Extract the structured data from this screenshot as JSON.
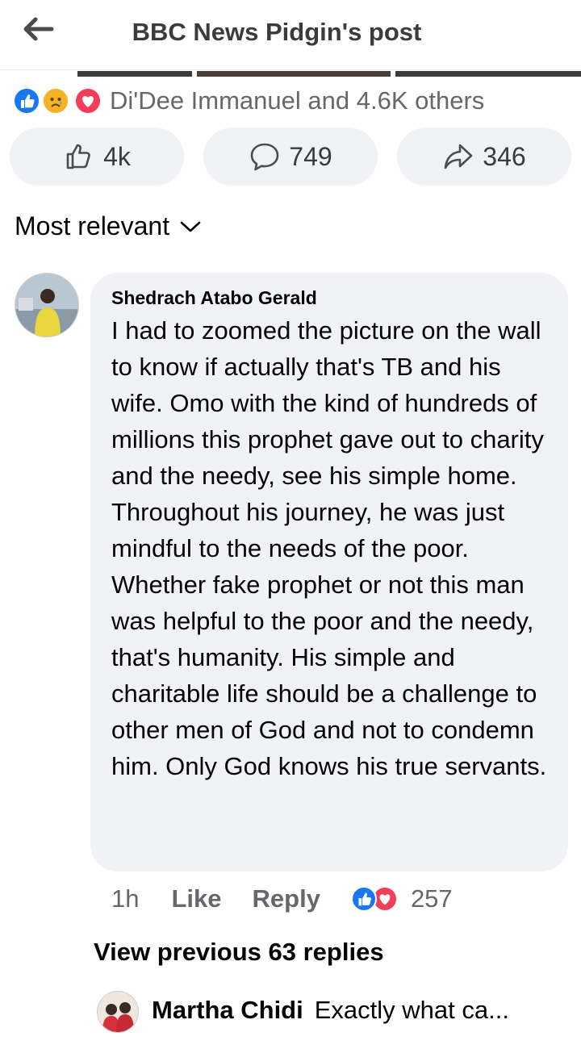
{
  "header": {
    "back_icon": "arrow-left-icon",
    "title": "BBC News Pidgin's post"
  },
  "post": {
    "reactions": {
      "icons": [
        "like-reaction-icon",
        "sad-reaction-icon",
        "love-reaction-icon"
      ],
      "summary": "Di'Dee Immanuel and 4.6K others"
    },
    "actions": [
      {
        "icon": "thumbs-up-icon",
        "count": "4k"
      },
      {
        "icon": "comment-icon",
        "count": "749"
      },
      {
        "icon": "share-icon",
        "count": "346"
      }
    ]
  },
  "comments_section": {
    "sort_label": "Most relevant",
    "comment": {
      "author": "Shedrach Atabo Gerald",
      "text": "I had to zoomed the picture on the wall to know if actually that's TB and his wife. Omo with the kind of hundreds of millions this prophet gave out to charity and the needy, see his simple home. Throughout his journey, he was just mindful to the needs of the poor. Whether fake prophet or not this man was helpful to the poor and the needy, that's humanity. His simple and charitable life should be a challenge to other men of God and not to condemn him. Only God knows his true servants.",
      "time": "1h",
      "like_label": "Like",
      "reply_label": "Reply",
      "reaction_count": "257"
    },
    "view_previous": "View previous 63 replies",
    "reply_preview": {
      "author": "Martha Chidi",
      "text": "Exactly what ca..."
    }
  },
  "colors": {
    "accent_blue": "#1877f2",
    "love_red": "#f33e58",
    "sad_yellow": "#f7b125",
    "pill_bg": "#f0f2f5",
    "secondary_text": "#65676b"
  }
}
